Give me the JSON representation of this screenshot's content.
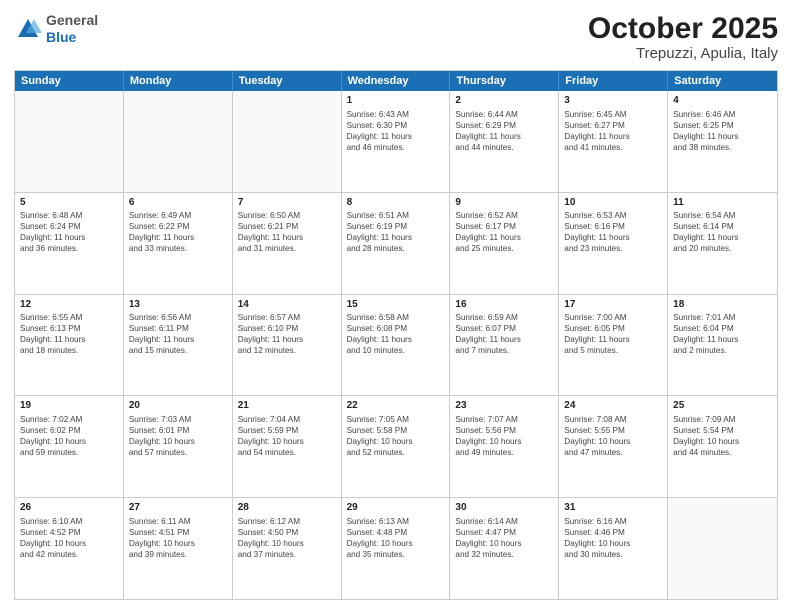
{
  "header": {
    "logo_general": "General",
    "logo_blue": "Blue",
    "title": "October 2025",
    "subtitle": "Trepuzzi, Apulia, Italy"
  },
  "days_of_week": [
    "Sunday",
    "Monday",
    "Tuesday",
    "Wednesday",
    "Thursday",
    "Friday",
    "Saturday"
  ],
  "weeks": [
    [
      {
        "day": "",
        "info": ""
      },
      {
        "day": "",
        "info": ""
      },
      {
        "day": "",
        "info": ""
      },
      {
        "day": "1",
        "info": "Sunrise: 6:43 AM\nSunset: 6:30 PM\nDaylight: 11 hours\nand 46 minutes."
      },
      {
        "day": "2",
        "info": "Sunrise: 6:44 AM\nSunset: 6:29 PM\nDaylight: 11 hours\nand 44 minutes."
      },
      {
        "day": "3",
        "info": "Sunrise: 6:45 AM\nSunset: 6:27 PM\nDaylight: 11 hours\nand 41 minutes."
      },
      {
        "day": "4",
        "info": "Sunrise: 6:46 AM\nSunset: 6:25 PM\nDaylight: 11 hours\nand 38 minutes."
      }
    ],
    [
      {
        "day": "5",
        "info": "Sunrise: 6:48 AM\nSunset: 6:24 PM\nDaylight: 11 hours\nand 36 minutes."
      },
      {
        "day": "6",
        "info": "Sunrise: 6:49 AM\nSunset: 6:22 PM\nDaylight: 11 hours\nand 33 minutes."
      },
      {
        "day": "7",
        "info": "Sunrise: 6:50 AM\nSunset: 6:21 PM\nDaylight: 11 hours\nand 31 minutes."
      },
      {
        "day": "8",
        "info": "Sunrise: 6:51 AM\nSunset: 6:19 PM\nDaylight: 11 hours\nand 28 minutes."
      },
      {
        "day": "9",
        "info": "Sunrise: 6:52 AM\nSunset: 6:17 PM\nDaylight: 11 hours\nand 25 minutes."
      },
      {
        "day": "10",
        "info": "Sunrise: 6:53 AM\nSunset: 6:16 PM\nDaylight: 11 hours\nand 23 minutes."
      },
      {
        "day": "11",
        "info": "Sunrise: 6:54 AM\nSunset: 6:14 PM\nDaylight: 11 hours\nand 20 minutes."
      }
    ],
    [
      {
        "day": "12",
        "info": "Sunrise: 6:55 AM\nSunset: 6:13 PM\nDaylight: 11 hours\nand 18 minutes."
      },
      {
        "day": "13",
        "info": "Sunrise: 6:56 AM\nSunset: 6:11 PM\nDaylight: 11 hours\nand 15 minutes."
      },
      {
        "day": "14",
        "info": "Sunrise: 6:57 AM\nSunset: 6:10 PM\nDaylight: 11 hours\nand 12 minutes."
      },
      {
        "day": "15",
        "info": "Sunrise: 6:58 AM\nSunset: 6:08 PM\nDaylight: 11 hours\nand 10 minutes."
      },
      {
        "day": "16",
        "info": "Sunrise: 6:59 AM\nSunset: 6:07 PM\nDaylight: 11 hours\nand 7 minutes."
      },
      {
        "day": "17",
        "info": "Sunrise: 7:00 AM\nSunset: 6:05 PM\nDaylight: 11 hours\nand 5 minutes."
      },
      {
        "day": "18",
        "info": "Sunrise: 7:01 AM\nSunset: 6:04 PM\nDaylight: 11 hours\nand 2 minutes."
      }
    ],
    [
      {
        "day": "19",
        "info": "Sunrise: 7:02 AM\nSunset: 6:02 PM\nDaylight: 10 hours\nand 59 minutes."
      },
      {
        "day": "20",
        "info": "Sunrise: 7:03 AM\nSunset: 6:01 PM\nDaylight: 10 hours\nand 57 minutes."
      },
      {
        "day": "21",
        "info": "Sunrise: 7:04 AM\nSunset: 5:59 PM\nDaylight: 10 hours\nand 54 minutes."
      },
      {
        "day": "22",
        "info": "Sunrise: 7:05 AM\nSunset: 5:58 PM\nDaylight: 10 hours\nand 52 minutes."
      },
      {
        "day": "23",
        "info": "Sunrise: 7:07 AM\nSunset: 5:56 PM\nDaylight: 10 hours\nand 49 minutes."
      },
      {
        "day": "24",
        "info": "Sunrise: 7:08 AM\nSunset: 5:55 PM\nDaylight: 10 hours\nand 47 minutes."
      },
      {
        "day": "25",
        "info": "Sunrise: 7:09 AM\nSunset: 5:54 PM\nDaylight: 10 hours\nand 44 minutes."
      }
    ],
    [
      {
        "day": "26",
        "info": "Sunrise: 6:10 AM\nSunset: 4:52 PM\nDaylight: 10 hours\nand 42 minutes."
      },
      {
        "day": "27",
        "info": "Sunrise: 6:11 AM\nSunset: 4:51 PM\nDaylight: 10 hours\nand 39 minutes."
      },
      {
        "day": "28",
        "info": "Sunrise: 6:12 AM\nSunset: 4:50 PM\nDaylight: 10 hours\nand 37 minutes."
      },
      {
        "day": "29",
        "info": "Sunrise: 6:13 AM\nSunset: 4:48 PM\nDaylight: 10 hours\nand 35 minutes."
      },
      {
        "day": "30",
        "info": "Sunrise: 6:14 AM\nSunset: 4:47 PM\nDaylight: 10 hours\nand 32 minutes."
      },
      {
        "day": "31",
        "info": "Sunrise: 6:16 AM\nSunset: 4:46 PM\nDaylight: 10 hours\nand 30 minutes."
      },
      {
        "day": "",
        "info": ""
      }
    ]
  ]
}
